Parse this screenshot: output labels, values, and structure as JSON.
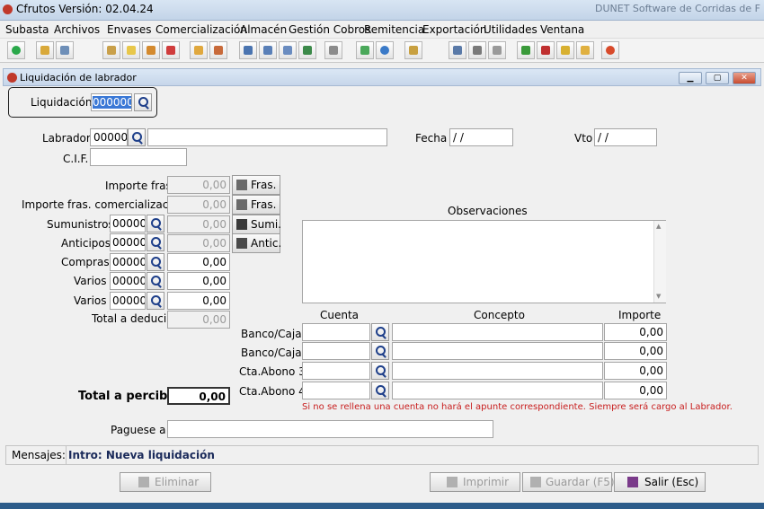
{
  "app": {
    "title": "Cfrutos Versión: 02.04.24",
    "right_title": "DUNET Software de Corridas de F"
  },
  "menu": [
    "Subasta",
    "Archivos",
    "Envases",
    "Comercialización",
    "Almacén",
    "Gestión Cobros",
    "Remitencia",
    "Exportación",
    "Utilidades",
    "Ventana"
  ],
  "toolbar_icons": [
    "power-icon",
    "folder-icon",
    "truck-icon",
    "clipboard-icon",
    "document-icon",
    "list-icon",
    "calendar-icon",
    "pencil-icon",
    "pencil-gear-icon",
    "print-icon",
    "print2-icon",
    "print3-icon",
    "chart-icon",
    "bus-icon",
    "money-icon",
    "globe-icon",
    "note-icon",
    "screen-icon",
    "calculator-icon",
    "printer-icon",
    "tree-icon",
    "search-refresh-icon",
    "key-icon",
    "lock-icon",
    "exit-icon"
  ],
  "window": {
    "title": "Liquidación de labrador"
  },
  "form": {
    "liquidacion": {
      "label": "Liquidación",
      "value": "000000"
    },
    "labrador": {
      "label": "Labrador",
      "code": "00000",
      "name": ""
    },
    "fecha": {
      "label": "Fecha",
      "value": " / /"
    },
    "vto": {
      "label": "Vto",
      "value": " / /"
    },
    "cif": {
      "label": "C.I.F.",
      "value": ""
    },
    "importe_fras": {
      "label": "Importe fras.",
      "value": "0,00",
      "button": "Fras."
    },
    "importe_fras_com": {
      "label": "Importe fras. comercialización",
      "value": "0,00",
      "button": "Fras."
    },
    "suministros": {
      "label": "Sumunistros",
      "code": "00000",
      "value": "0,00",
      "button": "Sumi."
    },
    "anticipos": {
      "label": "Anticipos",
      "code": "00000",
      "value": "0,00",
      "button": "Antic."
    },
    "compras": {
      "label": "Compras",
      "code": "00000",
      "value": "0,00"
    },
    "varios1": {
      "label": "Varios",
      "code": "00000",
      "value": "0,00"
    },
    "varios2": {
      "label": "Varios",
      "code": "00000",
      "value": "0,00"
    },
    "total_deducir": {
      "label": "Total a deducir",
      "value": "0,00"
    },
    "total_percibir": {
      "label": "Total a percibir",
      "value": "0,00"
    },
    "paguese": {
      "label": "Paguese a",
      "value": ""
    },
    "observaciones": {
      "label": "Observaciones",
      "value": ""
    },
    "accounts": {
      "headers": {
        "cuenta": "Cuenta",
        "concepto": "Concepto",
        "importe": "Importe"
      },
      "rows": [
        {
          "label": "Banco/Caja",
          "cuenta": "",
          "concepto": "",
          "importe": "0,00"
        },
        {
          "label": "Banco/Caja",
          "cuenta": "",
          "concepto": "",
          "importe": "0,00"
        },
        {
          "label": "Cta.Abono 3",
          "cuenta": "",
          "concepto": "",
          "importe": "0,00"
        },
        {
          "label": "Cta.Abono 4",
          "cuenta": "",
          "concepto": "",
          "importe": "0,00"
        }
      ],
      "warning": "Si no se rellena una cuenta no hará el apunte correspondiente. Siempre será cargo al Labrador."
    }
  },
  "status": {
    "label": "Mensajes:",
    "message": "Intro: Nueva liquidación"
  },
  "buttons": {
    "eliminar": "Eliminar",
    "imprimir": "Imprimir",
    "guardar": "Guardar (F5)",
    "salir": "Salir (Esc)"
  },
  "colors": {
    "warning": "#c81e1e",
    "status_text": "#1a2a5a",
    "accent": "#2d5c8a"
  }
}
